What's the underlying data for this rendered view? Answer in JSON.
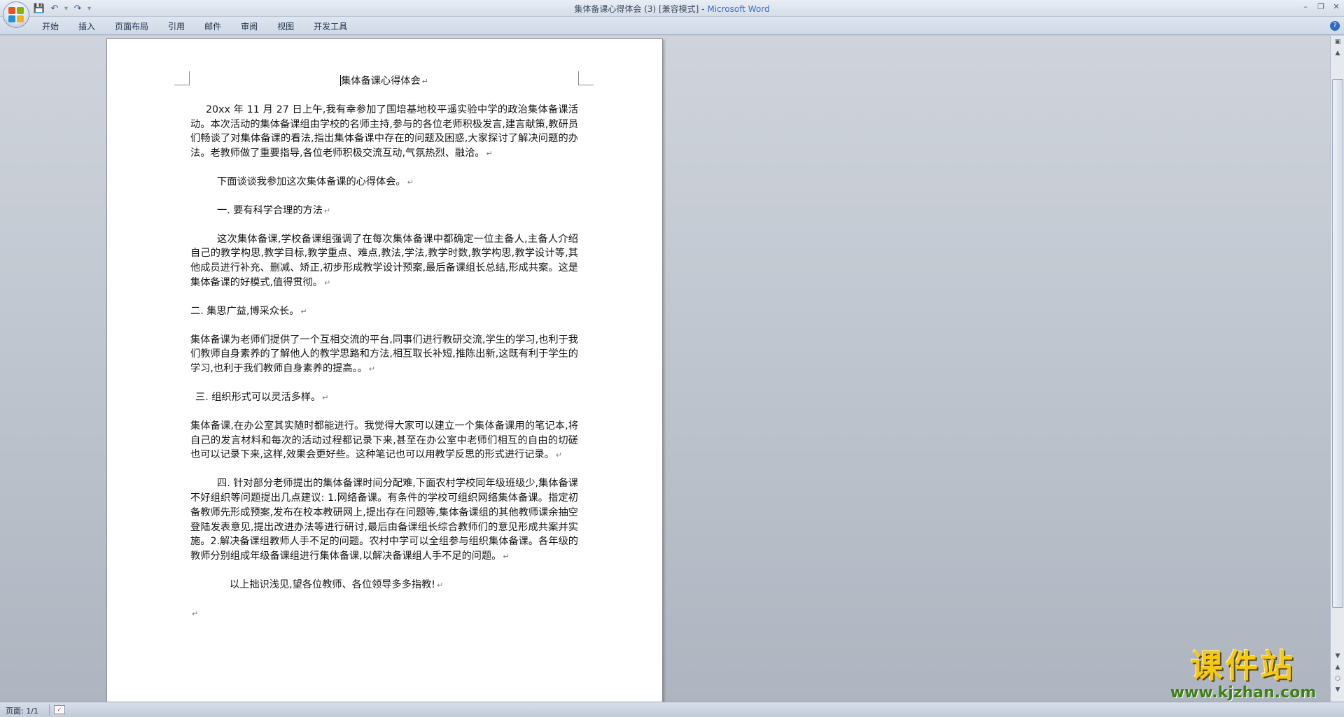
{
  "window": {
    "title": "集体备课心得体会 (3) [兼容模式]",
    "app_name": "Microsoft Word",
    "separator": " - "
  },
  "ribbon": {
    "tabs": [
      "开始",
      "插入",
      "页面布局",
      "引用",
      "邮件",
      "审阅",
      "视图",
      "开发工具"
    ]
  },
  "document": {
    "title": "集体备课心得体会",
    "paragraphs": [
      "20xx 年 11 月 27 日上午,我有幸参加了国培基地校平遥实验中学的政治集体备课活动。本次活动的集体备课组由学校的名师主持,参与的各位老师积极发言,建言献策,教研员们畅谈了对集体备课的看法,指出集体备课中存在的问题及困惑,大家探讨了解决问题的办法。老教师做了重要指导,各位老师积极交流互动,气氛热烈、融洽。",
      "下面谈谈我参加这次集体备课的心得体会。",
      "一. 要有科学合理的方法",
      "这次集体备课,学校备课组强调了在每次集体备课中都确定一位主备人,主备人介绍自己的教学构思,教学目标,教学重点、难点,教法,学法,教学时数,教学构思,教学设计等,其他成员进行补充、删减、矫正,初步形成教学设计预案,最后备课组长总结,形成共案。这是集体备课的好模式,值得贯彻。",
      "二. 集思广益,博采众长。",
      "集体备课为老师们提供了一个互相交流的平台,同事们进行教研交流,学生的学习,也利于我们教师自身素养的了解他人的教学思路和方法,相互取长补短,推陈出新,这既有利于学生的学习,也利于我们教师自身素养的提高。。",
      "三. 组织形式可以灵活多样。",
      "集体备课,在办公室其实随时都能进行。我觉得大家可以建立一个集体备课用的笔记本,将自己的发言材料和每次的活动过程都记录下来,甚至在办公室中老师们相互的自由的切磋也可以记录下来,这样,效果会更好些。这种笔记也可以用教学反思的形式进行记录。",
      "四. 针对部分老师提出的集体备课时间分配难,下面农村学校同年级班级少,集体备课不好组织等问题提出几点建议: 1.网络备课。有条件的学校可组织网络集体备课。指定初备教师先形成预案,发布在校本教研网上,提出存在问题等,集体备课组的其他教师课余抽空登陆发表意见,提出改进办法等进行研讨,最后由备课组长综合教师们的意见形成共案并实施。2.解决备课组教师人手不足的问题。农村中学可以全组参与组织集体备课。各年级的教师分别组成年级备课组进行集体备课,以解决备课组人手不足的问题。",
      "以上拙识浅见,望各位教师、各位领导多多指教!"
    ]
  },
  "status": {
    "page": "页面: 1/1"
  },
  "watermark": {
    "title": "课件站",
    "url": "www.kjzhan.com"
  },
  "colors": {
    "app_accent": "#3a6ec6",
    "workspace_bg": "#c3c9d3",
    "watermark_yellow": "#f5c814",
    "watermark_green": "#3f7f17"
  }
}
